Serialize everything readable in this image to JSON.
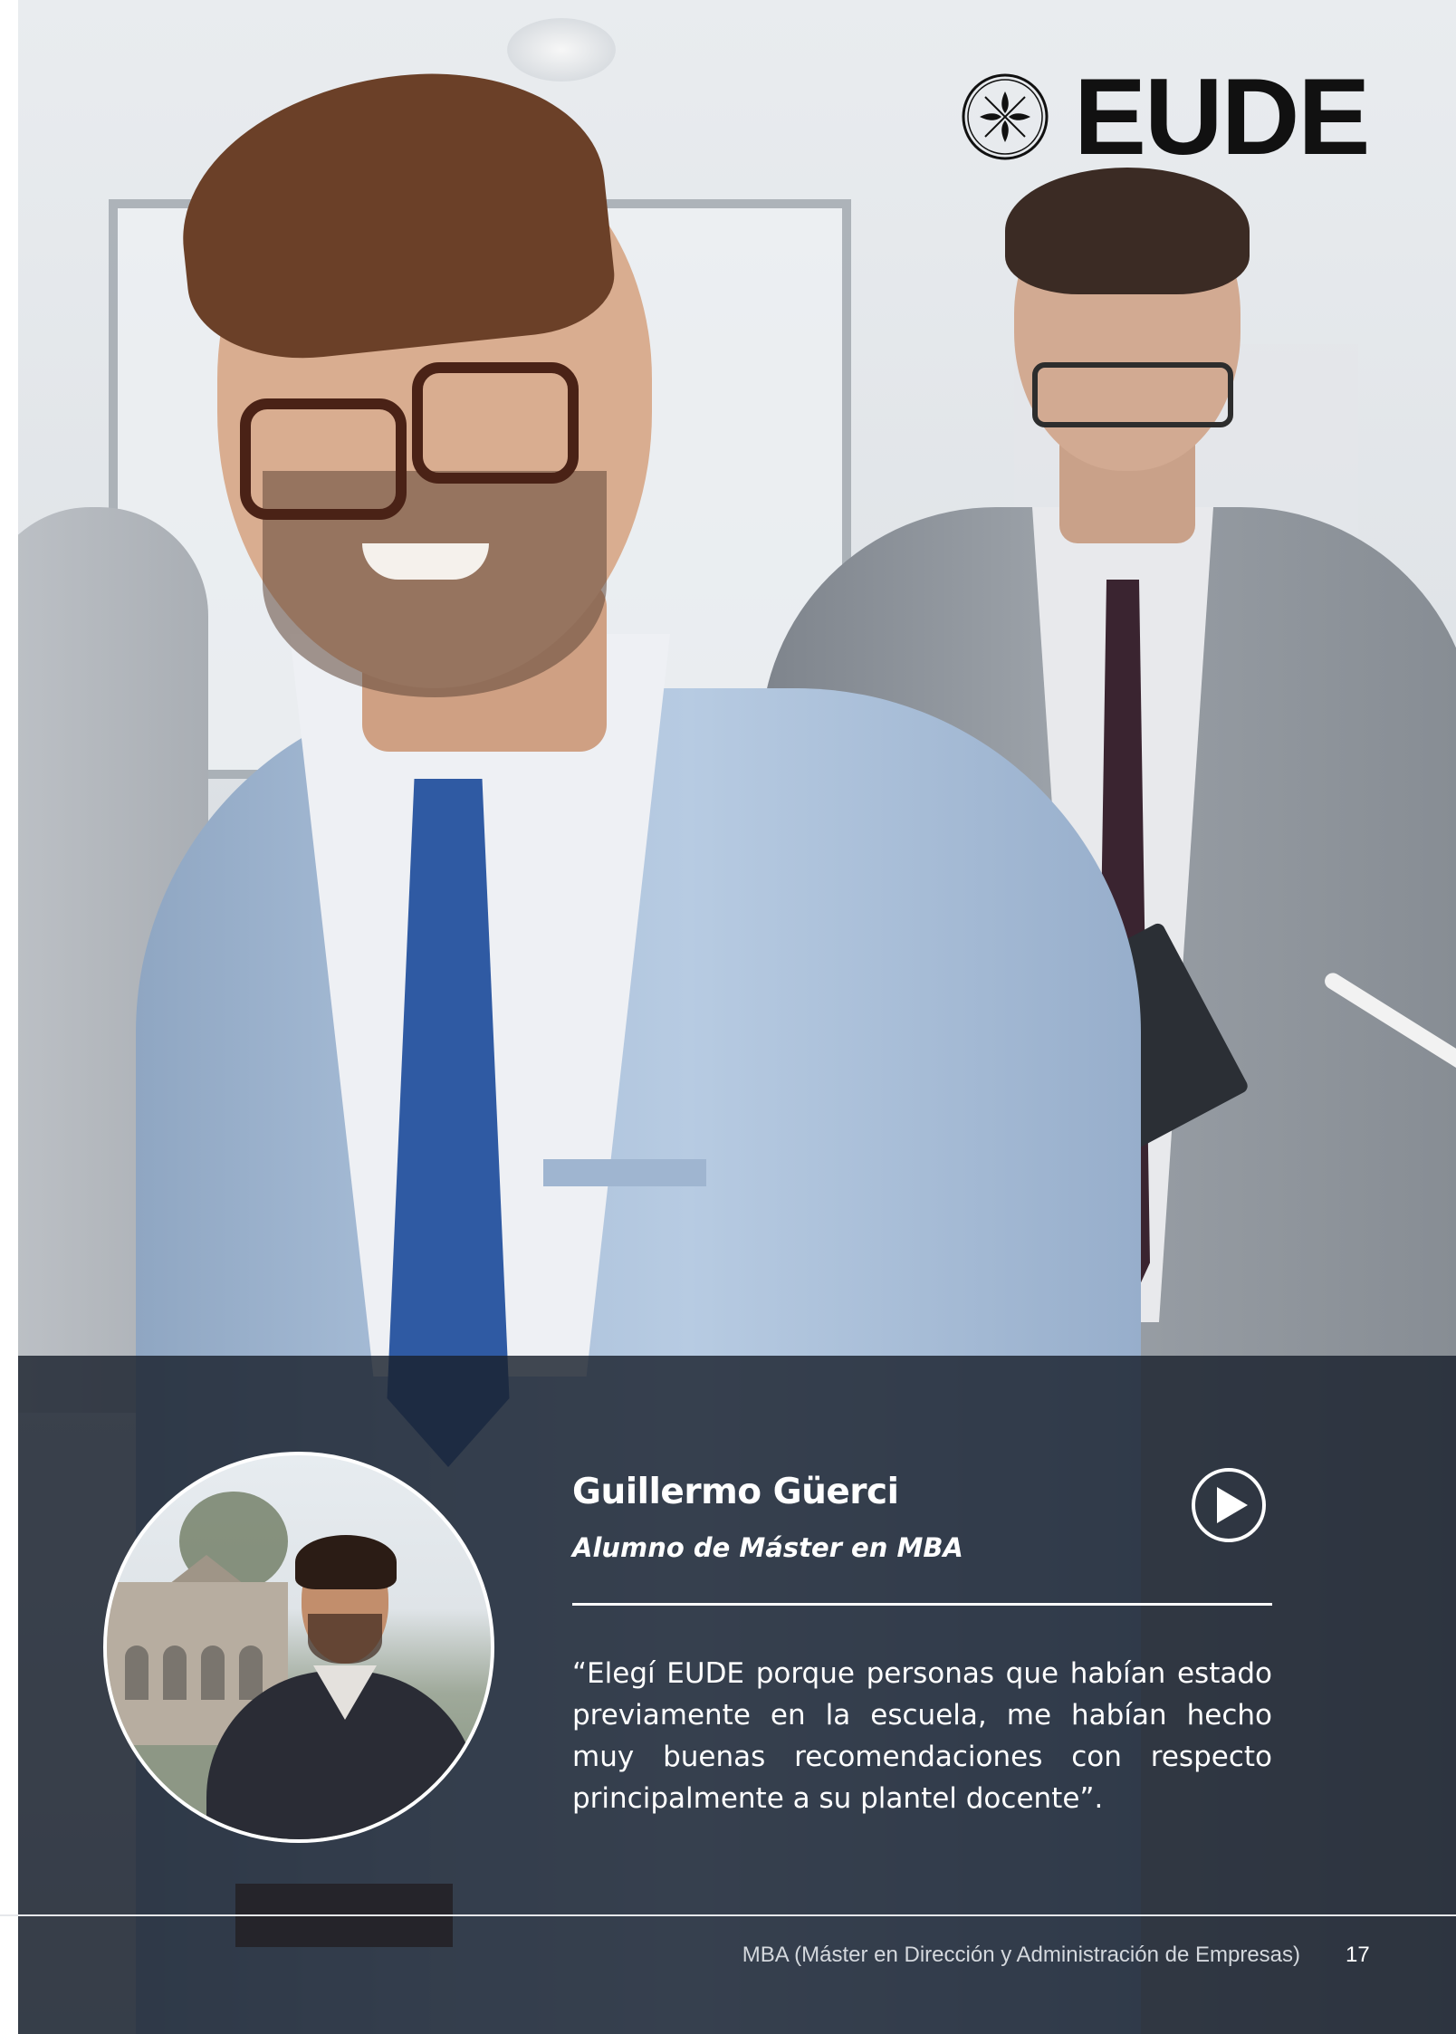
{
  "brand": {
    "name": "EUDE"
  },
  "testimonial": {
    "name": "Guillermo Güerci",
    "role": "Alumno de Máster en MBA",
    "quote": "“Elegí EUDE porque personas que habían estado previamente en la escuela, me habían hecho muy buenas recomendaciones con respecto principalmente a su plantel docente”.",
    "play_icon": "play-circle-icon"
  },
  "footer": {
    "document_title": "MBA (Máster en Dirección y Administración de Empresas)",
    "page_number": "17"
  },
  "colors": {
    "overlay": "#1a212d",
    "text_light": "#ffffff",
    "logo": "#111111"
  }
}
